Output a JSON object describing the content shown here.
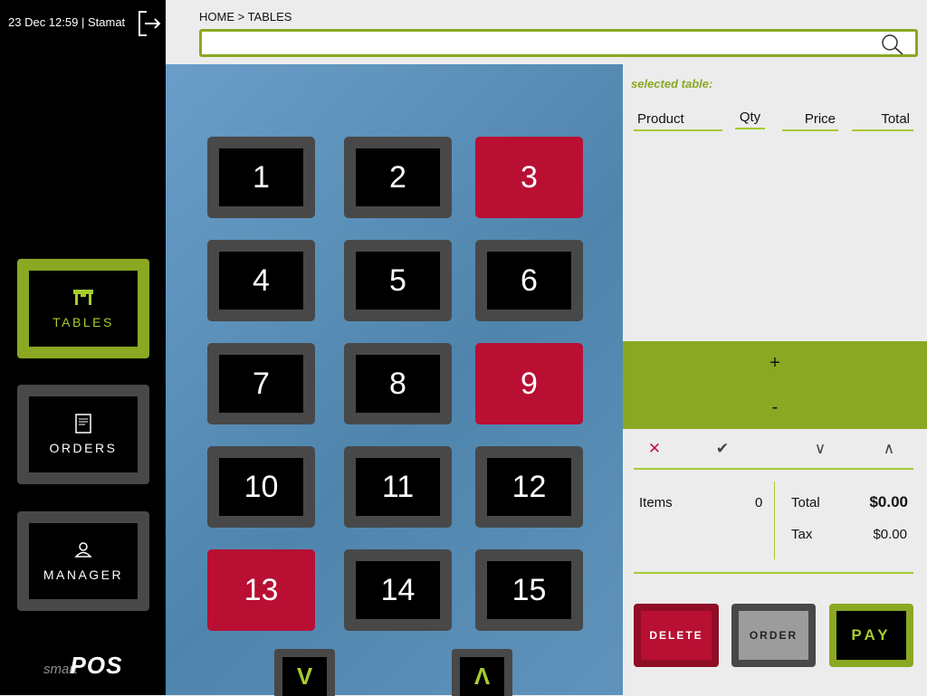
{
  "header": {
    "datetime": "23 Dec 12:59",
    "separator": "|",
    "user": "Stamat",
    "breadcrumb": "HOME > TABLES"
  },
  "search": {
    "value": "",
    "placeholder": ""
  },
  "sidebar": {
    "items": [
      {
        "label": "TABLES",
        "icon": "table-icon",
        "active": true
      },
      {
        "label": "ORDERS",
        "icon": "receipt-icon",
        "active": false
      },
      {
        "label": "MANAGER",
        "icon": "user-icon",
        "active": false
      }
    ],
    "brand": {
      "light": "smart",
      "bold": "POS"
    }
  },
  "tables": [
    {
      "number": "1",
      "occupied": false
    },
    {
      "number": "2",
      "occupied": false
    },
    {
      "number": "3",
      "occupied": true
    },
    {
      "number": "4",
      "occupied": false
    },
    {
      "number": "5",
      "occupied": false
    },
    {
      "number": "6",
      "occupied": false
    },
    {
      "number": "7",
      "occupied": false
    },
    {
      "number": "8",
      "occupied": false
    },
    {
      "number": "9",
      "occupied": true
    },
    {
      "number": "10",
      "occupied": false
    },
    {
      "number": "11",
      "occupied": false
    },
    {
      "number": "12",
      "occupied": false
    },
    {
      "number": "13",
      "occupied": true
    },
    {
      "number": "14",
      "occupied": false
    },
    {
      "number": "15",
      "occupied": false
    }
  ],
  "scroll": {
    "down_label": "V",
    "up_label": "Λ"
  },
  "order": {
    "selected_table_label": "selected table:",
    "columns": {
      "product": "Product",
      "qty": "Qty",
      "price": "Price",
      "total": "Total"
    },
    "qty_plus": "+",
    "qty_minus": "-",
    "actions": {
      "cancel": "✕",
      "confirm": "✔",
      "down": "∨",
      "up": "∧"
    },
    "items_label": "Items",
    "items_value": "0",
    "total_label": "Total",
    "total_value": "$0.00",
    "tax_label": "Tax",
    "tax_value": "$0.00",
    "buttons": {
      "delete": "DELETE",
      "order": "ORDER",
      "pay": "PAY"
    }
  },
  "colors": {
    "accent_green": "#8aa822",
    "occupied_red": "#b80f33",
    "tile_border": "#484848",
    "tables_bg": "#5b8fb8"
  }
}
